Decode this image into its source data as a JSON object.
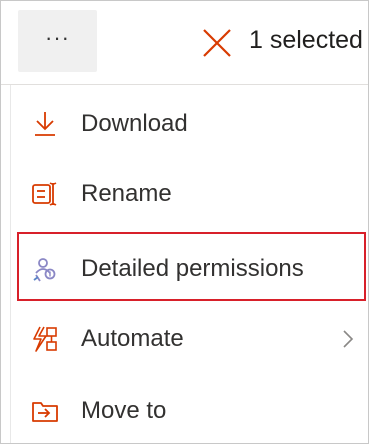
{
  "toolbar": {
    "more_label": "···",
    "selection_text": "1 selected"
  },
  "menu": {
    "items": [
      {
        "label": "Download",
        "icon": "download-icon"
      },
      {
        "label": "Rename",
        "icon": "rename-icon"
      },
      {
        "label": "Detailed permissions",
        "icon": "permissions-icon"
      },
      {
        "label": "Automate",
        "icon": "automate-icon",
        "has_submenu": true
      },
      {
        "label": "Move to",
        "icon": "move-to-icon"
      }
    ]
  },
  "colors": {
    "accent": "#d83b01",
    "highlight_border": "#d8202a",
    "permissions_icon": "#8a87c5",
    "text": "#323130"
  }
}
